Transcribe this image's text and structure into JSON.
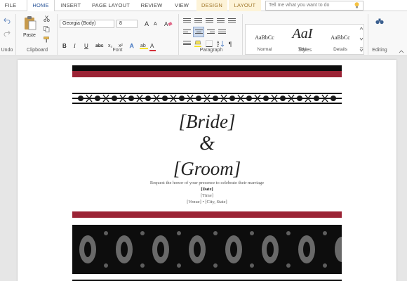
{
  "tabs": {
    "file": "FILE",
    "home": "HOME",
    "insert": "INSERT",
    "page_layout": "PAGE LAYOUT",
    "review": "REVIEW",
    "view": "VIEW",
    "design": "DESIGN",
    "layout": "LAYOUT"
  },
  "tell_me": {
    "placeholder": "Tell me what you want to do"
  },
  "ribbon": {
    "undo_label": "Undo",
    "clipboard_label": "Clipboard",
    "paste_label": "Paste",
    "font_label": "Font",
    "font_name": "Georgia (Body)",
    "font_size": "8",
    "grow_font": "A",
    "shrink_font": "A",
    "bold": "B",
    "italic": "I",
    "underline": "U",
    "strike": "abc",
    "subscript": "x₂",
    "superscript": "x²",
    "font_color": "A",
    "paragraph_label": "Paragraph",
    "styles_label": "Styles",
    "editing_label": "Editing",
    "styles": [
      {
        "preview": "AaBbCc",
        "name": "Normal"
      },
      {
        "preview": "AaI",
        "name": "Title"
      },
      {
        "preview": "AaBbCc",
        "name": "Details"
      }
    ]
  },
  "document": {
    "bride": "[Bride]",
    "ampersand": "&",
    "groom": "[Groom]",
    "request_line": "Request the honor of your presence to celebrate their marriage",
    "date": "[Date]",
    "time": "[Time]",
    "venue_line": "[Venue] • [City, State]"
  },
  "colors": {
    "accent_red": "#9b2335",
    "black_band": "#0d0d0d",
    "word_blue": "#2b579a",
    "context_tab": "#fdf3d8"
  }
}
